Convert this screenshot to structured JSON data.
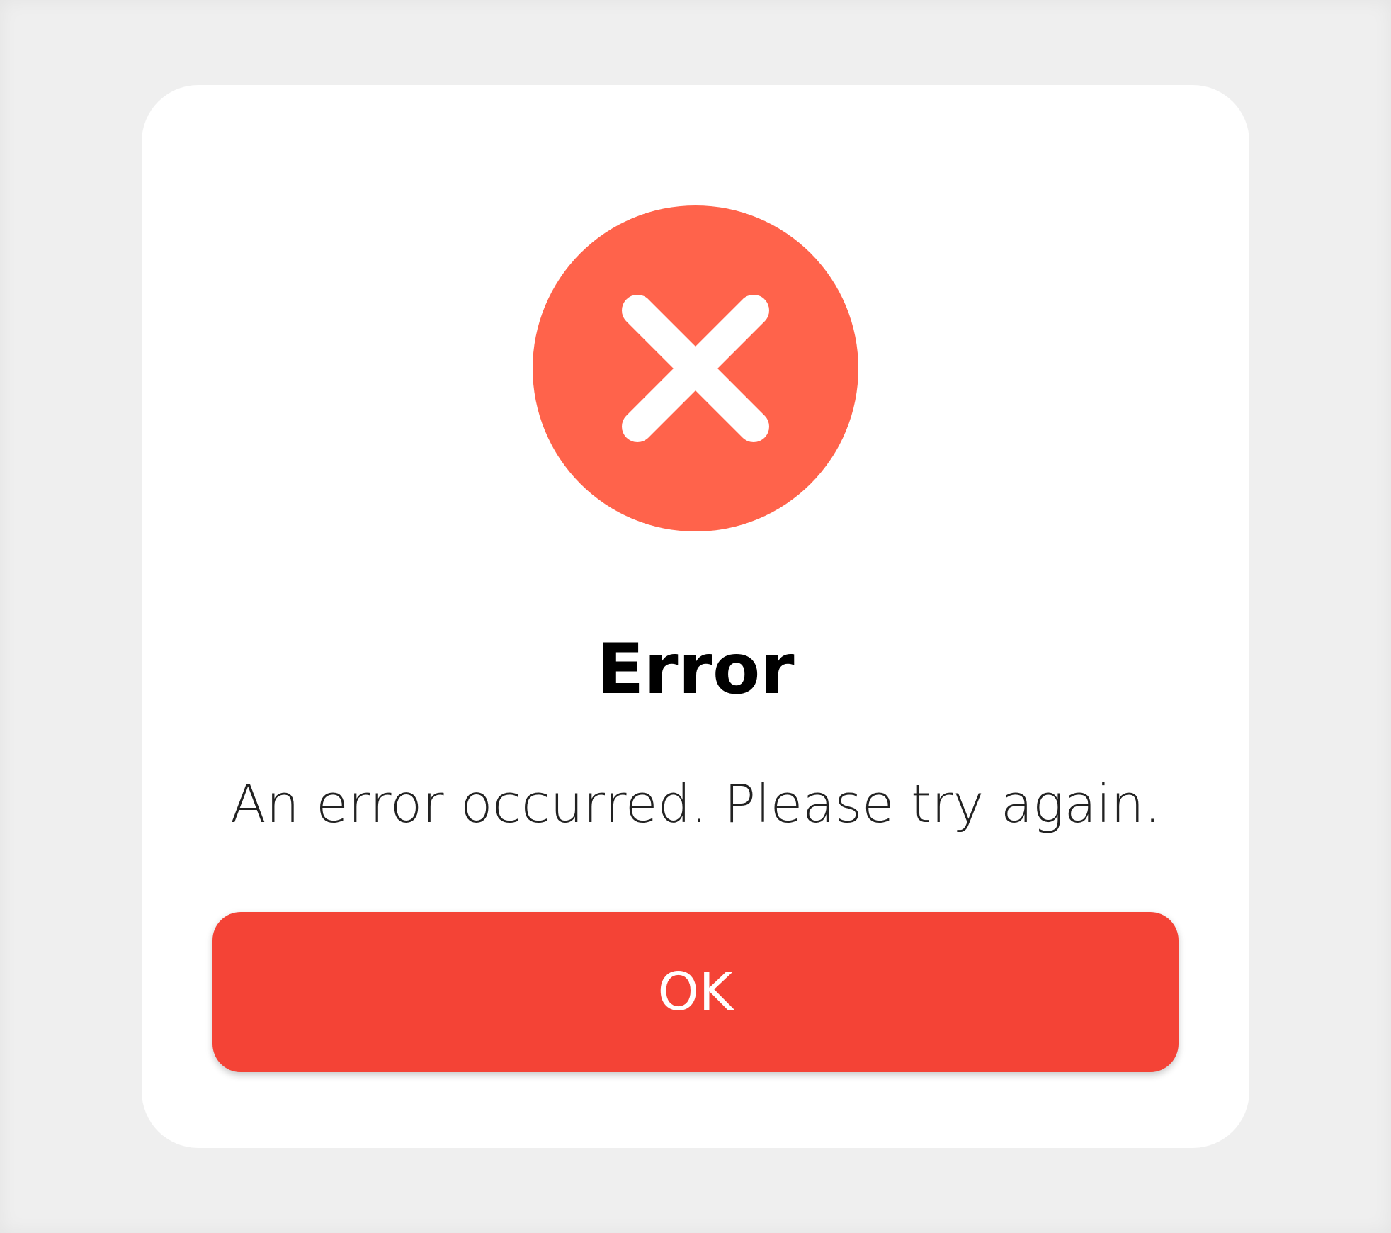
{
  "dialog": {
    "icon": "close-icon",
    "title": "Error",
    "message": "An error occurred. Please try again.",
    "ok_label": "OK"
  },
  "colors": {
    "background": "#efefef",
    "card": "#ffffff",
    "icon_circle": "#ff634b",
    "button": "#f44336",
    "title_text": "#000000",
    "message_text": "#222222",
    "button_text": "#ffffff"
  }
}
